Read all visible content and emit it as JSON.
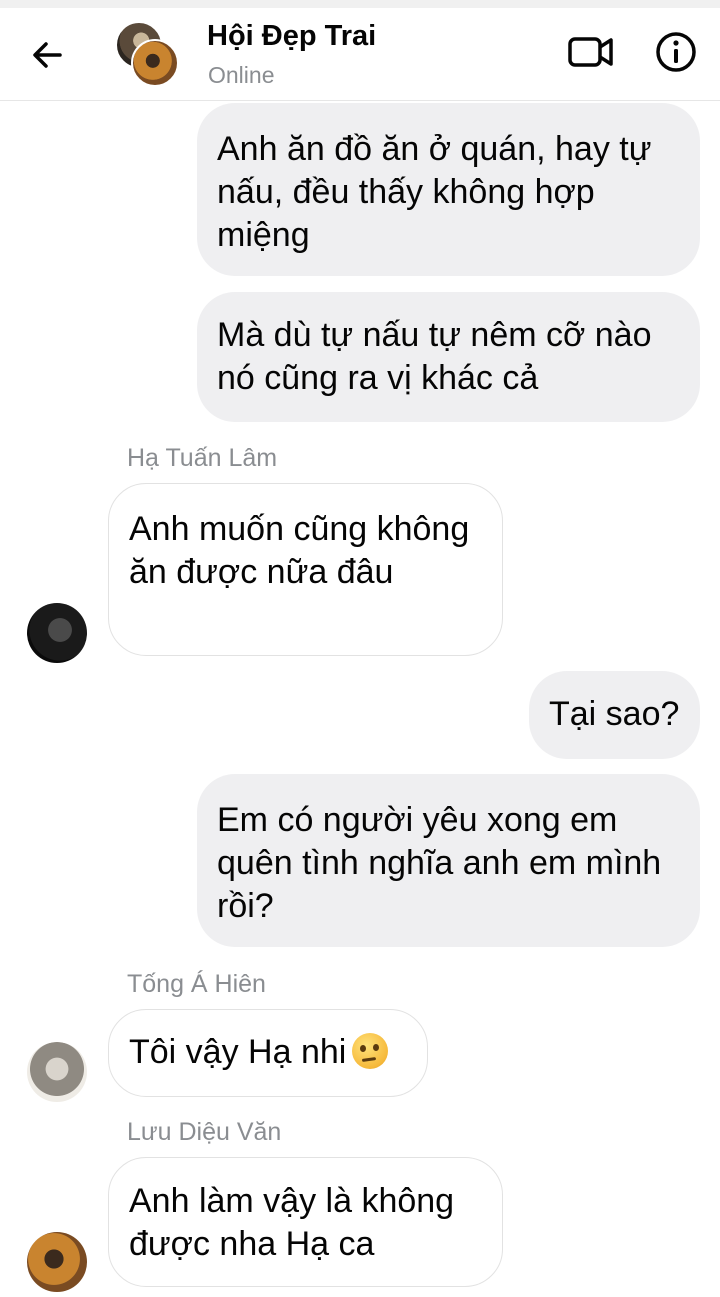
{
  "header": {
    "title": "Hội Đẹp Trai",
    "status": "Online",
    "back_icon": "arrow-left-icon",
    "video_icon": "video-camera-icon",
    "info_icon": "info-icon"
  },
  "messages": [
    {
      "direction": "out",
      "text": "Anh ăn đồ ăn ở quán, hay tự nấu, đều thấy không hợp miệng"
    },
    {
      "direction": "out",
      "text": "Mà dù tự nấu tự nêm cỡ nào nó cũng ra vị khác cả"
    },
    {
      "direction": "in",
      "sender": "Hạ Tuấn Lâm",
      "text": "Anh muốn cũng không ăn được nữa đâu"
    },
    {
      "direction": "out",
      "text": "Tại sao?"
    },
    {
      "direction": "out",
      "text": "Em có người yêu xong em quên tình nghĩa anh em mình rồi?"
    },
    {
      "direction": "in",
      "sender": "Tống Á Hiên",
      "text": "Tôi vậy Hạ nhi",
      "emoji": "face-with-raised-eyebrow"
    },
    {
      "direction": "in",
      "sender": "Lưu Diệu Văn",
      "text": "Anh làm vậy là không được nha Hạ ca"
    }
  ],
  "colors": {
    "outgoing_bubble": "#efeff1",
    "incoming_border": "#e2e2e2",
    "muted_text": "#8a8d91"
  }
}
